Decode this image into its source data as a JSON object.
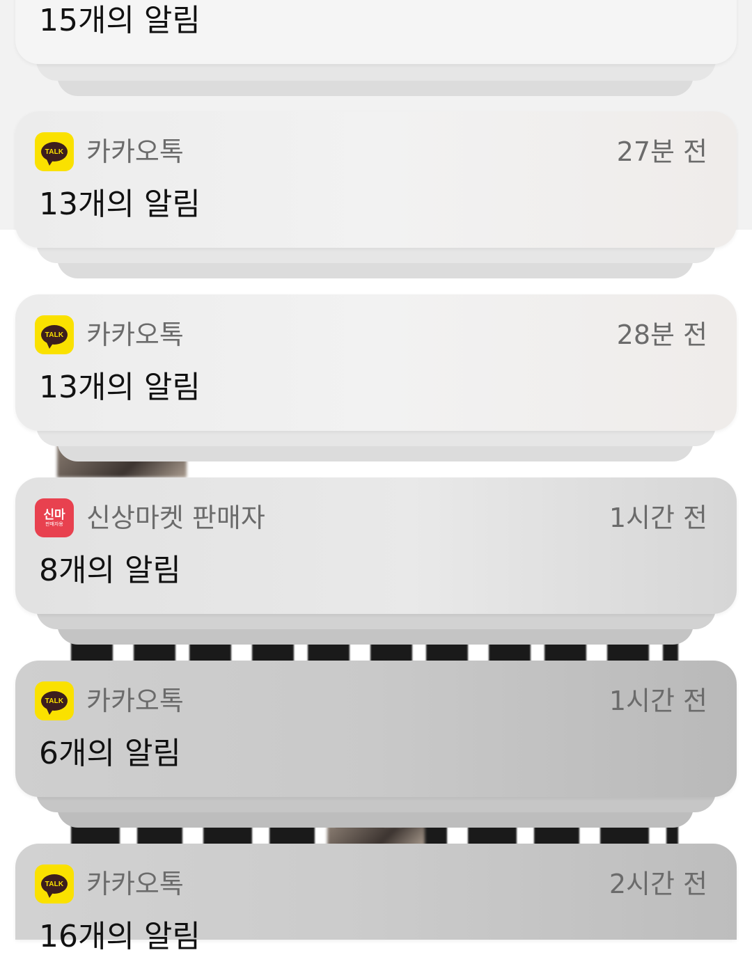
{
  "notifications": [
    {
      "app": "",
      "time": "",
      "count_text": "15개의 알림",
      "icon": ""
    },
    {
      "app": "카카오톡",
      "time": "27분 전",
      "count_text": "13개의 알림",
      "icon": "kakaotalk-icon"
    },
    {
      "app": "카카오톡",
      "time": "28분 전",
      "count_text": "13개의 알림",
      "icon": "kakaotalk-icon"
    },
    {
      "app": "신상마켓 판매자",
      "time": "1시간 전",
      "count_text": "8개의 알림",
      "icon": "shinsang-market-icon"
    },
    {
      "app": "카카오톡",
      "time": "1시간 전",
      "count_text": "6개의 알림",
      "icon": "kakaotalk-icon"
    },
    {
      "app": "카카오톡",
      "time": "2시간 전",
      "count_text": "16개의 알림",
      "icon": "kakaotalk-icon"
    }
  ],
  "icons": {
    "kakao_label": "TALK",
    "shinma_label": "신마",
    "shinma_sub": "판매자용"
  },
  "colors": {
    "kakao_yellow": "#fae100",
    "kakao_brown": "#3c1e1e",
    "shinma_red": "#e8414f"
  }
}
